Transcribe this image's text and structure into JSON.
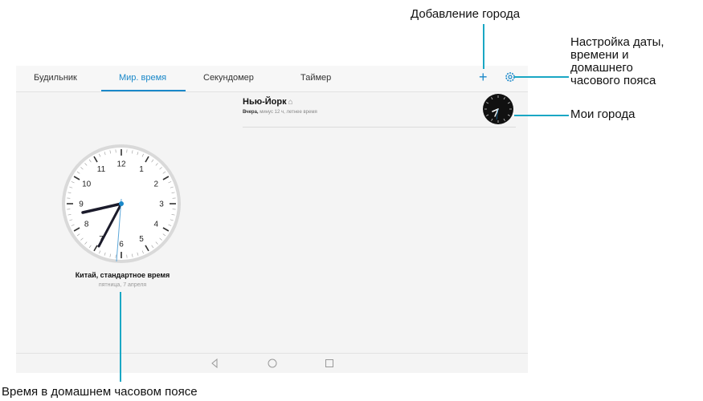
{
  "tabs": [
    {
      "label": "Будильник"
    },
    {
      "label": "Мир. время"
    },
    {
      "label": "Секундомер"
    },
    {
      "label": "Таймер"
    }
  ],
  "toolbar": {
    "add_city_icon": "plus-icon",
    "settings_icon": "gear-icon"
  },
  "city": {
    "name": "Нью-Йорк",
    "day": "Вчера,",
    "detail": " минус 12 ч, летнее время"
  },
  "home": {
    "title": "Китай, стандартное время",
    "date": "пятница, 7 апреля"
  },
  "clock_numerals": [
    "12",
    "1",
    "2",
    "3",
    "4",
    "5",
    "6",
    "7",
    "8",
    "9",
    "10",
    "11"
  ],
  "annotations": {
    "add_city": "Добавление города",
    "settings_line1": "Настройка даты,",
    "settings_line2": "времени и",
    "settings_line3": "домашнего",
    "settings_line4": "часового пояса",
    "my_cities": "Мои города",
    "home_time": "Время в домашнем часовом поясе"
  },
  "colors": {
    "accent": "#1a88c9",
    "callout": "#1aa7c4",
    "hand": "#1b1b2b"
  }
}
